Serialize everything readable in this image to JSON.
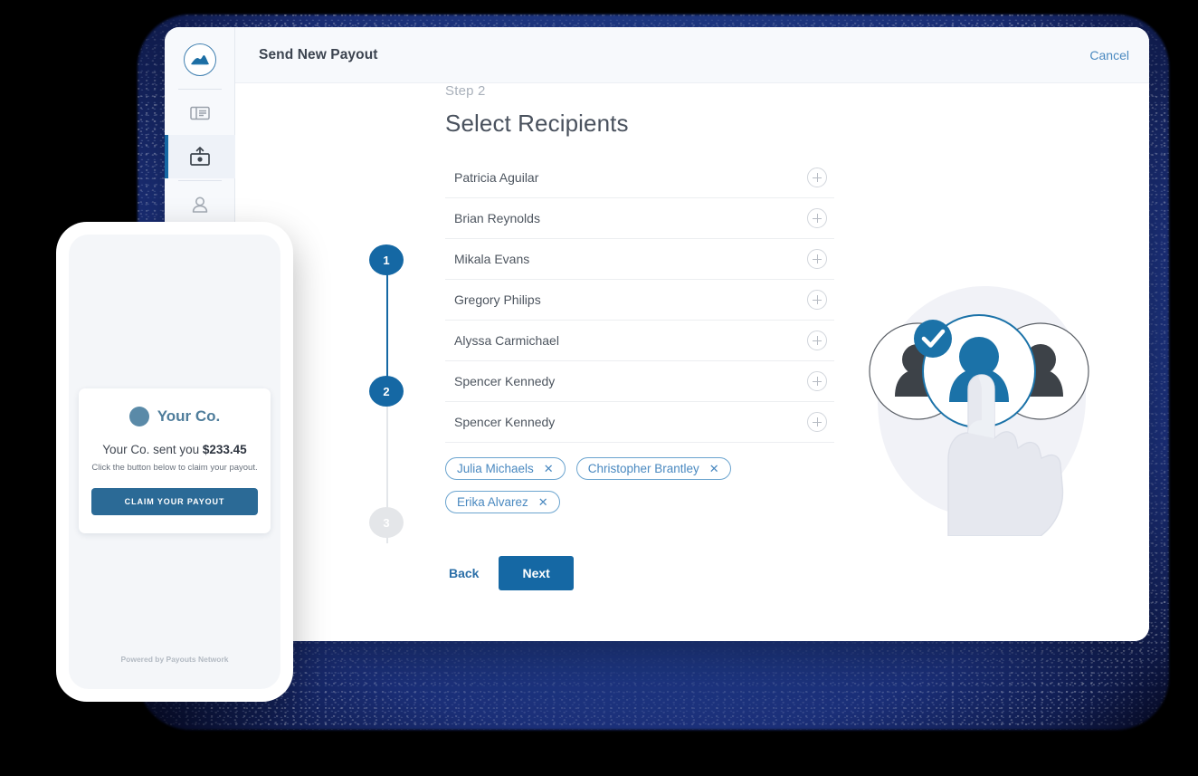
{
  "app": {
    "logo_icon": "mountain-logo-icon",
    "header_title": "Send New Payout",
    "cancel_label": "Cancel",
    "accent_blue": "#1568a4",
    "link_blue": "#4a89c0",
    "backdrop_navy": "#21408f"
  },
  "sidebar": {
    "items": [
      {
        "icon": "id-card-icon",
        "active": false
      },
      {
        "icon": "payout-upload-icon",
        "active": true
      },
      {
        "icon": "person-icon",
        "active": false
      }
    ]
  },
  "stepper": {
    "steps": [
      {
        "number": "1",
        "state": "done"
      },
      {
        "number": "2",
        "state": "current"
      },
      {
        "number": "3",
        "state": "upcoming"
      }
    ]
  },
  "form": {
    "step_label": "Step 2",
    "title": "Select Recipients",
    "recipients": [
      {
        "name": "Patricia Aguilar",
        "add_icon": "plus-icon"
      },
      {
        "name": "Brian Reynolds",
        "add_icon": "plus-icon"
      },
      {
        "name": "Mikala Evans",
        "add_icon": "plus-icon"
      },
      {
        "name": "Gregory Philips",
        "add_icon": "plus-icon"
      },
      {
        "name": "Alyssa Carmichael",
        "add_icon": "plus-icon"
      },
      {
        "name": "Spencer Kennedy",
        "add_icon": "plus-icon"
      },
      {
        "name": "Spencer Kennedy",
        "add_icon": "plus-icon"
      }
    ],
    "selected_chips": [
      {
        "name": "Julia Michaels",
        "remove_icon": "close-icon",
        "remove_glyph": "✕"
      },
      {
        "name": "Christopher Brantley",
        "remove_icon": "close-icon",
        "remove_glyph": "✕"
      },
      {
        "name": "Erika Alvarez",
        "remove_icon": "close-icon",
        "remove_glyph": "✕"
      }
    ],
    "back_label": "Back",
    "next_label": "Next"
  },
  "illustration": {
    "name": "select-recipient-illustration",
    "description": "three avatar circles with the middle one selected and a pointing hand",
    "selected_badge_icon": "check-circle-icon"
  },
  "phone": {
    "brand_name": "Your Co.",
    "brand_dot_icon": "brand-avatar-icon",
    "sent_prefix": "Your Co. sent you ",
    "amount": "$233.45",
    "instruction": "Click the button below to claim your payout.",
    "claim_button_label": "CLAIM YOUR PAYOUT",
    "footer": "Powered by Payouts Network"
  }
}
